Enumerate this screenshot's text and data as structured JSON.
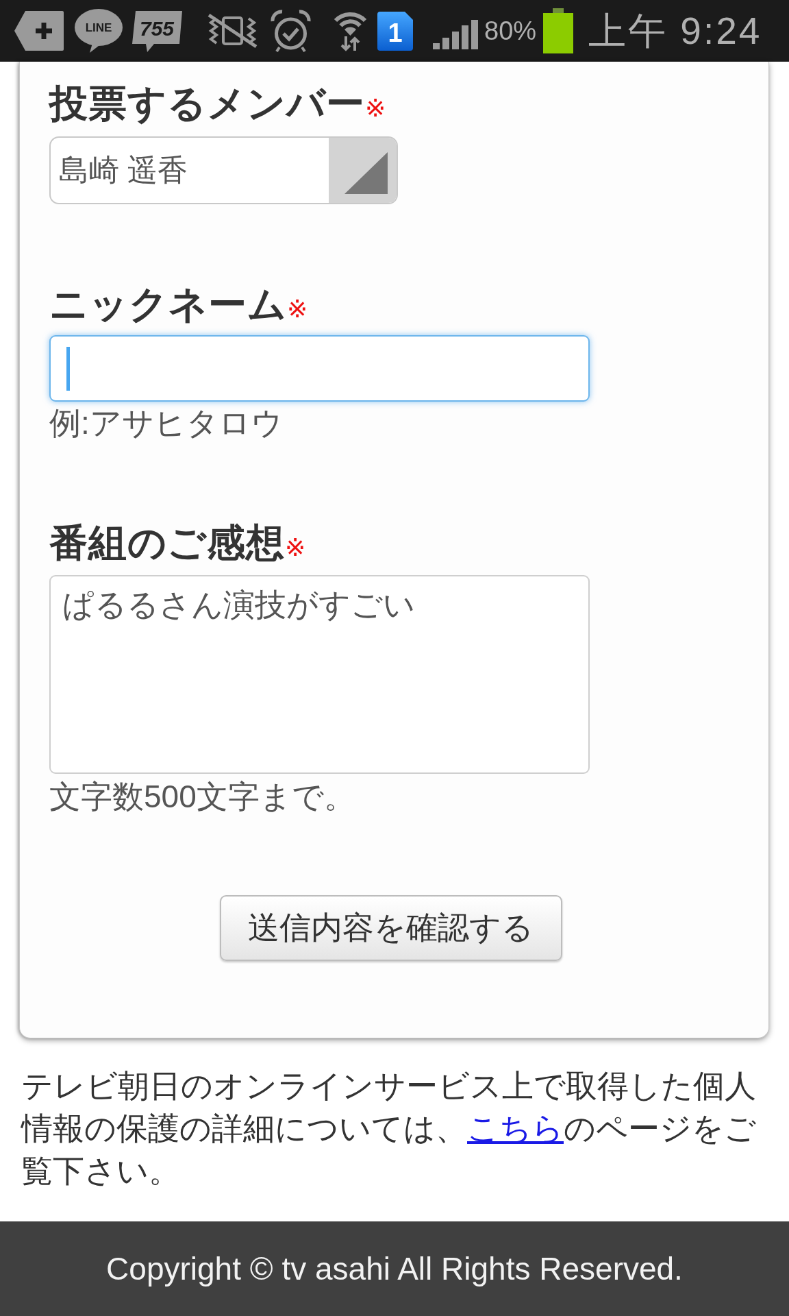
{
  "status_bar": {
    "notifications": [
      {
        "kind": "tag-plus"
      },
      {
        "kind": "chat-bubble",
        "label": "LINE"
      },
      {
        "kind": "speech-box",
        "label": "755"
      }
    ],
    "indicators": [
      {
        "kind": "vibrate-off"
      },
      {
        "kind": "alarm"
      },
      {
        "kind": "wifi"
      },
      {
        "kind": "number-tile",
        "label": "1"
      },
      {
        "kind": "signal"
      },
      {
        "kind": "battery-percent",
        "text": "80%"
      },
      {
        "kind": "battery"
      }
    ],
    "time": "上午 9:24"
  },
  "form": {
    "fields": [
      {
        "kind": "select",
        "label": "投票するメンバー",
        "required_mark": "※",
        "focused": false,
        "value": "島崎 遥香"
      },
      {
        "kind": "text",
        "label": "ニックネーム",
        "required_mark": "※",
        "focused": true,
        "hint": "例:アサヒタロウ"
      },
      {
        "kind": "textarea",
        "label": "番組のご感想",
        "required_mark": "※",
        "focused": false,
        "value": "ぱるるさん演技がすごい",
        "hint": "文字数500文字まで。"
      }
    ],
    "submit_button": "送信内容を確認する"
  },
  "privacy_notice": {
    "text_before_link": "テレビ朝日のオンラインサービス上で取得した個人情報の保護の詳細については、",
    "link": "こちら",
    "text_after_link": "のページをご覧下さい。"
  },
  "footer": {
    "copyright": "Copyright © tv asahi All Rights Reserved."
  }
}
